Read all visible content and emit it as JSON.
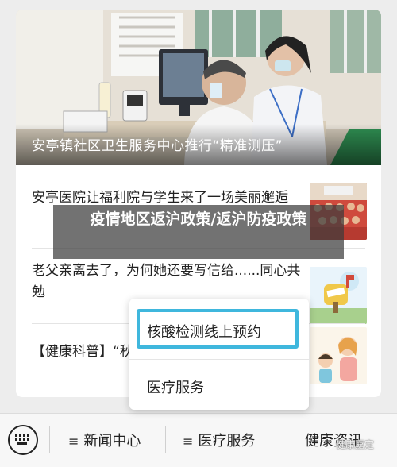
{
  "hero": {
    "title": "安亭镇社区卫生服务中心推行“精准测压”"
  },
  "articles": [
    {
      "title": "安亭医院让福利院与学生来了一场美丽邂逅",
      "thumb": "group-photo"
    },
    {
      "title": "老父亲离去了，为何她还要写信给......同心共勉",
      "thumb": "mailbox-illustration"
    },
    {
      "title": "【健康科普】“秋",
      "thumb": "family-cartoon"
    }
  ],
  "banner": {
    "text": "疫情地区返沪政策/返沪防疫政策"
  },
  "popup": {
    "items": [
      {
        "label": "核酸检测线上预约",
        "highlighted": true
      },
      {
        "label": "医疗服务",
        "highlighted": false
      }
    ],
    "highlight_color": "#3fb7dd"
  },
  "bottombar": {
    "keyboard_icon": "keyboard-icon",
    "tabs": [
      {
        "label": "新闻中心",
        "icon": "≡"
      },
      {
        "label": "医疗服务",
        "icon": "≡"
      },
      {
        "label": "健康资讯"
      }
    ]
  },
  "watermark": {
    "text": "健康嘉定"
  }
}
